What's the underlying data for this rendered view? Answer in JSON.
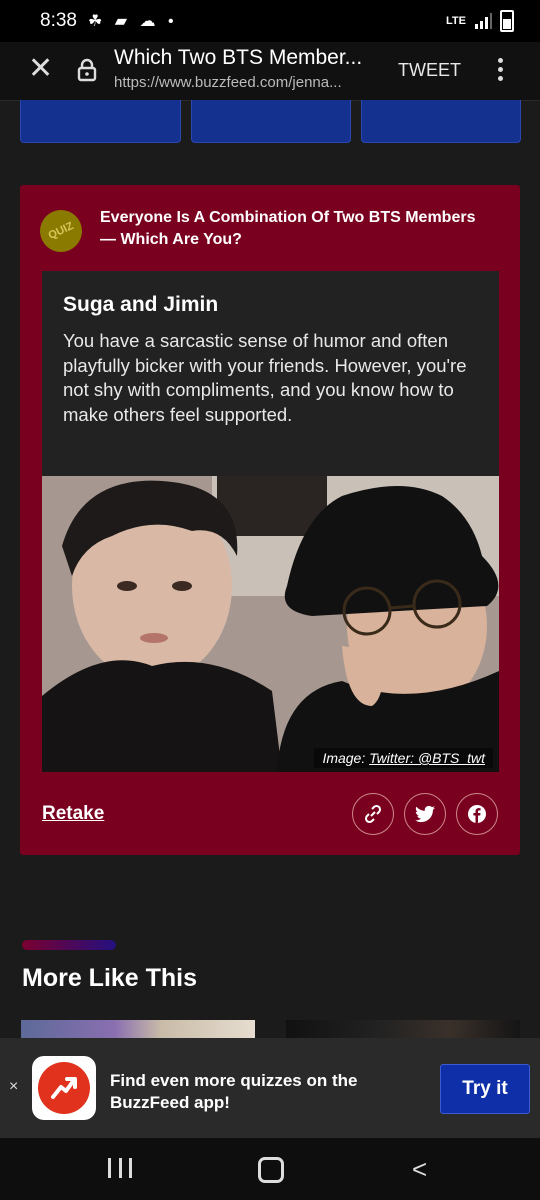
{
  "status_bar": {
    "time": "8:38",
    "network": "LTE"
  },
  "browser": {
    "page_title": "Which Two BTS Member...",
    "url": "https://www.buzzfeed.com/jenna...",
    "tweet_label": "TWEET"
  },
  "quiz_card": {
    "badge": "QUIZ",
    "heading": "Everyone Is A Combination Of Two BTS Members — Which Are You?",
    "result_title": "Suga and Jimin",
    "result_description": "You have a sarcastic sense of humor and often playfully bicker with your friends. However, you're not shy with compliments, and you know how to make others feel supported.",
    "image_caption_prefix": "Image: ",
    "image_caption_link": "Twitter: @BTS_twt",
    "retake_label": "Retake"
  },
  "more_section": {
    "title": "More Like This"
  },
  "app_banner": {
    "close_label": "×",
    "text": "Find even more quizzes on the BuzzFeed app!",
    "button_label": "Try it"
  },
  "colors": {
    "card_bg": "#7a0020",
    "button_blue": "#0f2fa8",
    "page_bg": "#1b1b1b"
  }
}
